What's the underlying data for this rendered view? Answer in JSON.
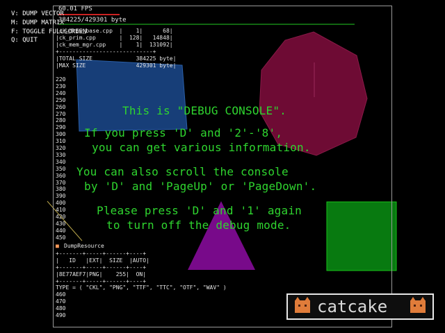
{
  "hud": {
    "fps": "60.01 FPS",
    "memory": "384225/429301 byte",
    "keys": [
      "V: DUMP VECTOR",
      "M: DUMP MATRIX",
      "F: TOGGLE FULLSCREEN",
      "Q: QUIT"
    ]
  },
  "resource_table": {
    "rows": [
      "|ck_draw_base.cpp  |    1|      68|",
      "|ck_prim.cpp       |  128|   14848|",
      "|ck_mem_mgr.cpp    |    1|  131092|"
    ],
    "divider": "+----------------------------+",
    "totals": [
      "|TOTAL SIZE             384225 byte|",
      "|MAX SIZE               429301 byte|"
    ]
  },
  "console_lines": [
    "220",
    "230",
    "240",
    "250",
    "260",
    "270",
    "280",
    "290",
    "300",
    "310",
    "320",
    "330",
    "340",
    "350",
    "360",
    "370",
    "380",
    "390",
    "400",
    "410",
    "420",
    "430",
    "440",
    "450"
  ],
  "message": {
    "line1": "This is \"DEBUG CONSOLE\".",
    "line2": "If you press 'D' and '2'-'8',",
    "line3": "you can get various information.",
    "line4": "You can also scroll the console",
    "line5": "by 'D' and 'PageUp' or 'PageDown'.",
    "line6": "Please press 'D' and '1' again",
    "line7": "to turn off the debug mode."
  },
  "dump_resource": {
    "title": "DumpResource",
    "border": "+-------+-----+------+----+",
    "header": "|   ID   |EXT|  SIZE  |AUTO|",
    "row": "|8E77AEF7|PNG|    255|  ON|",
    "types": "TYPE = ( \"CKL\", \"PNG\", \"TTF\", \"TTC\", \"OTF\", \"WAV\" )"
  },
  "tail_lines": [
    "460",
    "470",
    "480",
    "490"
  ],
  "logo": {
    "text": "catcake"
  },
  "colors": {
    "console_text": "#2fd52f",
    "blue_box": "#1d4a8c",
    "sphere": "#7a0c3a",
    "triangle": "#7b0a8a",
    "green_box": "#0a7a10"
  }
}
